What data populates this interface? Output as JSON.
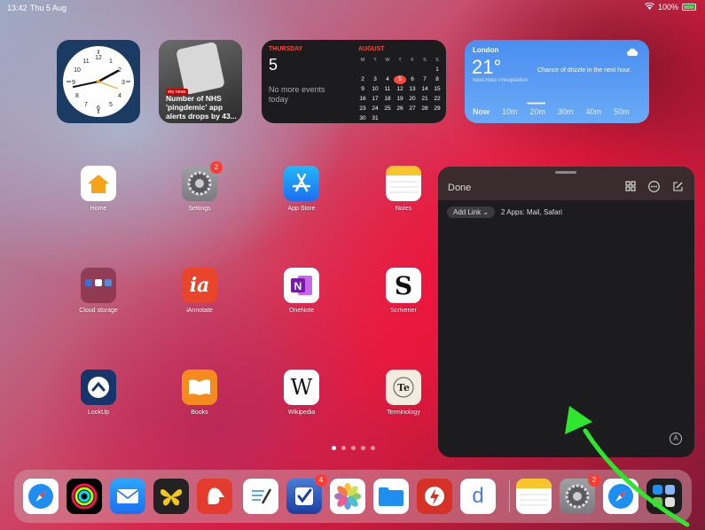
{
  "status": {
    "time": "13:42",
    "date": "Thu 5 Aug",
    "battery": "100%"
  },
  "widgets": {
    "news": {
      "source": "sky news",
      "headline": "Number of NHS 'pingdemic' app alerts drops by 43..."
    },
    "calendar": {
      "weekday": "THURSDAY",
      "day": "5",
      "no_events": "No more events today",
      "month": "AUGUST",
      "headers": [
        "M",
        "T",
        "W",
        "T",
        "F",
        "S",
        "S"
      ],
      "days": [
        "",
        "",
        "",
        "",
        "",
        "",
        "1",
        "2",
        "3",
        "4",
        "5",
        "6",
        "7",
        "8",
        "9",
        "10",
        "11",
        "12",
        "13",
        "14",
        "15",
        "16",
        "17",
        "18",
        "19",
        "20",
        "21",
        "22",
        "23",
        "24",
        "25",
        "26",
        "27",
        "28",
        "29",
        "30",
        "31"
      ],
      "today": "5"
    },
    "weather": {
      "city": "London",
      "temp": "21°",
      "description": "Chance of drizzle in the next hour.",
      "subtitle": "Next-Hour Precipitation",
      "times": [
        "Now",
        "10m",
        "20m",
        "30m",
        "40m",
        "50m"
      ]
    }
  },
  "apps": [
    {
      "label": "Home"
    },
    {
      "label": "Settings",
      "badge": "2"
    },
    {
      "label": "App Store"
    },
    {
      "label": "Notes"
    },
    {
      "label": "Cloud storage"
    },
    {
      "label": "iAnnotate"
    },
    {
      "label": "OneNote"
    },
    {
      "label": "Scrivener"
    },
    {
      "label": "LookUp"
    },
    {
      "label": "Books"
    },
    {
      "label": "Wikipedia"
    },
    {
      "label": "Terminology"
    }
  ],
  "dock": {
    "things_badge": "4",
    "settings_badge": "2"
  },
  "panel": {
    "done": "Done",
    "add_link": "Add Link",
    "apps_label": "2 Apps: Mail, Safari"
  },
  "colors": {
    "accent_red": "#ff3b30",
    "arrow_green": "#2ee62e"
  }
}
